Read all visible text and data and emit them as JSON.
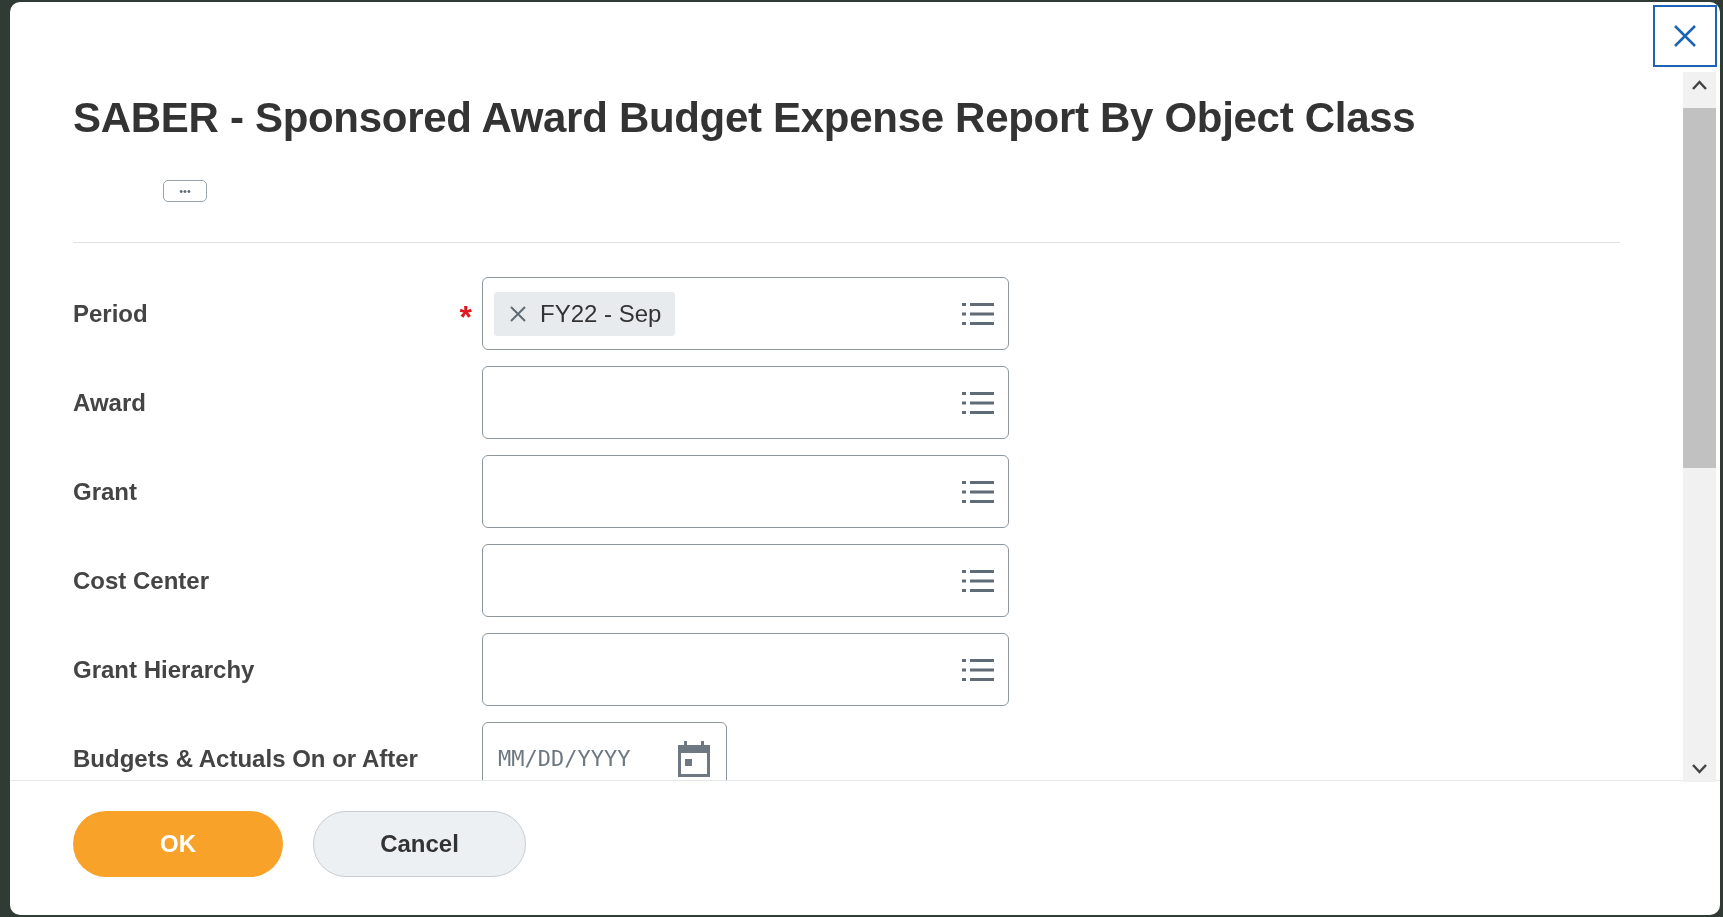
{
  "dialog": {
    "title": "SABER - Sponsored Award Budget Expense Report By Object Class",
    "more_button": "•••",
    "required_symbol": "*"
  },
  "fields": [
    {
      "label": "Period",
      "kind": "prompt",
      "required": true,
      "values": [
        "FY22 - Sep"
      ]
    },
    {
      "label": "Award",
      "kind": "prompt",
      "required": false
    },
    {
      "label": "Grant",
      "kind": "prompt",
      "required": false
    },
    {
      "label": "Cost Center",
      "kind": "prompt",
      "required": false
    },
    {
      "label": "Grant Hierarchy",
      "kind": "prompt",
      "required": false
    },
    {
      "label": "Budgets & Actuals On or After",
      "kind": "date",
      "required": false,
      "placeholder": "MM/DD/YYYY"
    }
  ],
  "buttons": [
    {
      "label": "OK",
      "kind": "primary"
    },
    {
      "label": "Cancel",
      "kind": "secondary"
    }
  ]
}
